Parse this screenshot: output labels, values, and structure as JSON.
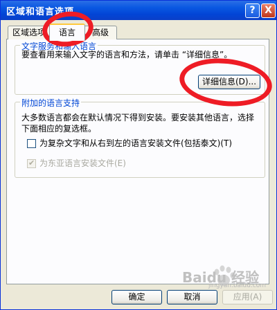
{
  "window": {
    "title": "区域和语言选项",
    "help_symbol": "?",
    "close_symbol": "X"
  },
  "tabs": [
    {
      "label": "区域选项"
    },
    {
      "label": "语言"
    },
    {
      "label": "高级"
    }
  ],
  "text_services": {
    "legend": "文字服务和输入语言",
    "description": "要查看用来输入文字的语言和方法，请单击 “详细信息”。",
    "details_button": "详细信息(D)..."
  },
  "supplemental": {
    "legend": "附加的语言支持",
    "description": "大多数语言都会在默认情况下得到安装。要安装其他语言，选择下面相应的复选框。",
    "complex_script": {
      "label": "为复杂文字和从右到左的语言安装文件(包括泰文)(T)",
      "checked": false
    },
    "east_asian": {
      "label": "为东亚语言安装文件(E)",
      "checked": true,
      "enabled": false
    }
  },
  "buttons": {
    "ok": "确定",
    "cancel": "取消",
    "apply": "应用(A)"
  },
  "watermark": {
    "text": "Baidu 经验",
    "sub": "jingyan.baidu.com"
  },
  "colors": {
    "annotation": "#ee1c25",
    "titlebar": "#0a58e2",
    "group_legend": "#0046d5"
  }
}
